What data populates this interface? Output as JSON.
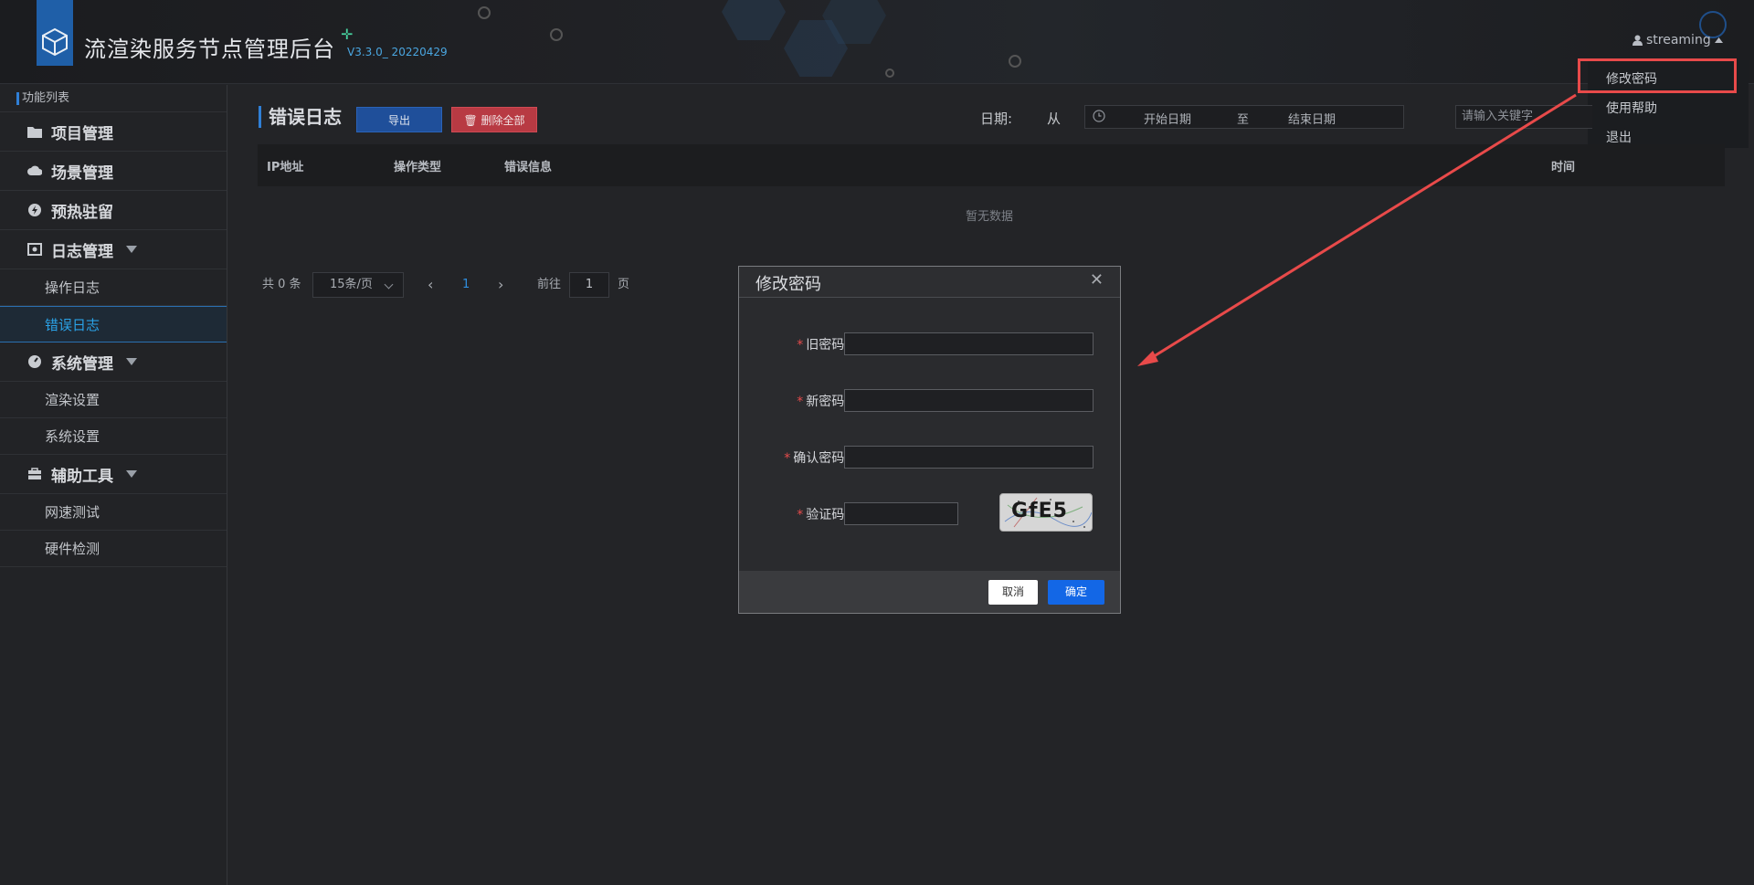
{
  "header": {
    "app_title": "流渲染服务节点管理后台",
    "version": "V3.3.0_ 20220429",
    "user_name": "streaming",
    "user_menu": {
      "change_password": "修改密码",
      "help": "使用帮助",
      "logout": "退出"
    }
  },
  "sidebar": {
    "heading": "功能列表",
    "groups": [
      {
        "label": "项目管理",
        "icon": "folder-icon"
      },
      {
        "label": "场景管理",
        "icon": "cloud-icon"
      },
      {
        "label": "预热驻留",
        "icon": "bolt-icon"
      },
      {
        "label": "日志管理",
        "icon": "log-icon",
        "children": [
          "操作日志",
          "错误日志"
        ]
      },
      {
        "label": "系统管理",
        "icon": "gauge-icon",
        "children": [
          "渲染设置",
          "系统设置"
        ]
      },
      {
        "label": "辅助工具",
        "icon": "toolbox-icon",
        "children": [
          "网速测试",
          "硬件检测"
        ]
      }
    ],
    "active_item": "错误日志"
  },
  "main": {
    "title": "错误日志",
    "export_label": "导出",
    "delete_all_label": "删除全部",
    "date_label": "日期:",
    "from_label": "从",
    "start_date_placeholder": "开始日期",
    "to_label": "至",
    "end_date_placeholder": "结束日期",
    "keyword_placeholder": "请输入关键字",
    "table": {
      "columns": [
        "IP地址",
        "操作类型",
        "错误信息",
        "时间"
      ],
      "empty_text": "暂无数据"
    },
    "pagination": {
      "total": "共 0 条",
      "page_size": "15条/页",
      "current_page": "1",
      "goto_label": "前往",
      "goto_value": "1",
      "page_suffix": "页"
    }
  },
  "modal": {
    "title": "修改密码",
    "fields": {
      "old_password": "旧密码:",
      "new_password": "新密码:",
      "confirm_password": "确认密码:",
      "captcha": "验证码:"
    },
    "captcha_text": "GfE5",
    "cancel_label": "取消",
    "ok_label": "确定"
  },
  "colors": {
    "accent": "#1367e6",
    "danger": "#b83a43",
    "annotation": "#e84a4a",
    "active_nav": "#2aa3e8"
  }
}
